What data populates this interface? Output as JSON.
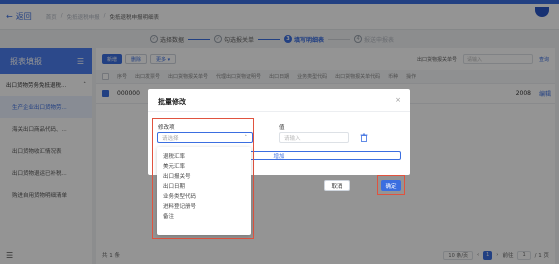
{
  "header": {
    "back_label": "返回",
    "crumbs": [
      "首页",
      "/",
      "免抵退税申报",
      "/",
      "免抵退税申报明细表"
    ]
  },
  "steps": [
    {
      "num": "✓",
      "label": "选择数据",
      "state": "done"
    },
    {
      "num": "✓",
      "label": "勾选报关单",
      "state": "done"
    },
    {
      "num": "3",
      "label": "填写明细表",
      "state": "current"
    },
    {
      "num": "4",
      "label": "报送申报表",
      "state": "todo"
    }
  ],
  "sidebar": {
    "title": "报表填报",
    "items": [
      {
        "label": "出口货物劳务免抵退税...",
        "type": "parent"
      },
      {
        "label": "生产企业出口货物劳...",
        "type": "active"
      },
      {
        "label": "海关出口商品代码、...",
        "type": "sub"
      },
      {
        "label": "出口货物收汇情况表",
        "type": "sub"
      },
      {
        "label": "出口货物退运已补税...",
        "type": "sub"
      },
      {
        "label": "购进自用货物明细清单",
        "type": "sub"
      }
    ]
  },
  "toolbar": {
    "add_label": "新增",
    "delete_label": "删除",
    "more_label": "更多 ▾",
    "search_label": "出口货物报关单号",
    "search_placeholder": "请输入",
    "query_label": "查询"
  },
  "table": {
    "headers": [
      "序号",
      "出口发票号",
      "出口货物报关单号",
      "代理出口货物证明号",
      "出口日期",
      "业务类型代码",
      "出口货物报关单代码",
      "币种",
      "操作"
    ],
    "rows": [
      {
        "num": "000000",
        "amount": "2008",
        "action": "编辑"
      }
    ]
  },
  "pager": {
    "total_label": "共 1 条",
    "page_size": "10 条/页",
    "current_page": "1",
    "goto_prefix": "前往",
    "goto_value": "1",
    "goto_suffix": "/ 1 页"
  },
  "modal": {
    "title": "批量修改",
    "close_icon": "close-icon",
    "field_label": "修改项",
    "field_placeholder": "请选择",
    "value_label": "值",
    "value_placeholder": "请输入",
    "add_label": "增加",
    "cancel_label": "取消",
    "confirm_label": "确定",
    "options": [
      "退税汇率",
      "美元汇率",
      "出口报关号",
      "出口日期",
      "业务类型代码",
      "进料登记册号",
      "备注"
    ]
  },
  "colors": {
    "accent": "#3b6ee0",
    "highlight": "#e0533f"
  }
}
